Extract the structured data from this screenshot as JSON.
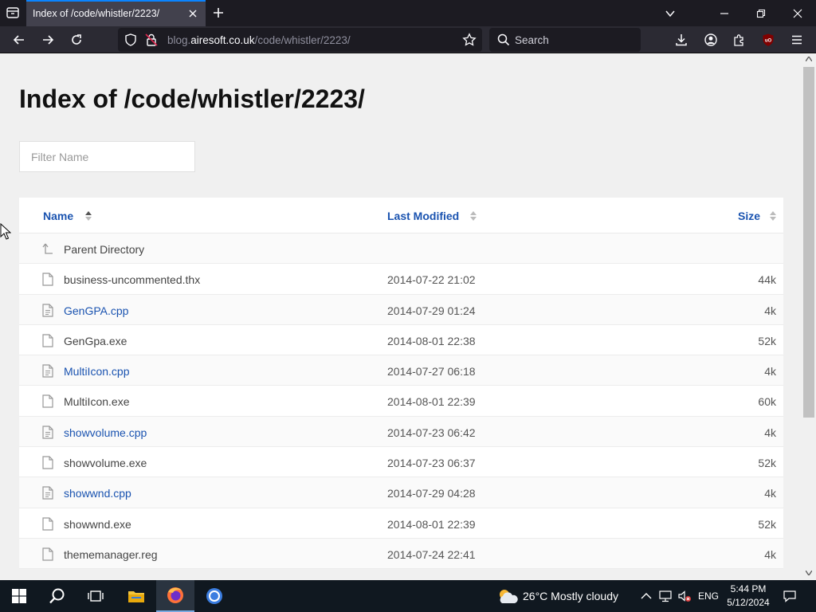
{
  "browser": {
    "tab_title": "Index of /code/whistler/2223/",
    "url_prefix": "blog.",
    "url_host": "airesoft.co.uk",
    "url_path": "/code/whistler/2223/",
    "search_placeholder": "Search"
  },
  "page": {
    "title": "Index of /code/whistler/2223/",
    "filter_placeholder": "Filter Name",
    "columns": {
      "name": "Name",
      "modified": "Last Modified",
      "size": "Size"
    },
    "parent_label": "Parent Directory",
    "files": [
      {
        "name": "business-uncommented.thx",
        "modified": "2014-07-22 21:02",
        "size": "44k"
      },
      {
        "name": "GenGPA.cpp",
        "modified": "2014-07-29 01:24",
        "size": "4k"
      },
      {
        "name": "GenGpa.exe",
        "modified": "2014-08-01 22:38",
        "size": "52k"
      },
      {
        "name": "MultiIcon.cpp",
        "modified": "2014-07-27 06:18",
        "size": "4k"
      },
      {
        "name": "MultiIcon.exe",
        "modified": "2014-08-01 22:39",
        "size": "60k"
      },
      {
        "name": "showvolume.cpp",
        "modified": "2014-07-23 06:42",
        "size": "4k"
      },
      {
        "name": "showvolume.exe",
        "modified": "2014-07-23 06:37",
        "size": "52k"
      },
      {
        "name": "showwnd.cpp",
        "modified": "2014-07-29 04:28",
        "size": "4k"
      },
      {
        "name": "showwnd.exe",
        "modified": "2014-08-01 22:39",
        "size": "52k"
      },
      {
        "name": "thememanager.reg",
        "modified": "2014-07-24 22:41",
        "size": "4k"
      }
    ]
  },
  "taskbar": {
    "weather": "26°C  Mostly cloudy",
    "language": "ENG",
    "time": "5:44 PM",
    "date": "5/12/2024"
  },
  "colors": {
    "link": "#1a53b0",
    "tab_accent": "#0a84ff",
    "chrome_dark": "#1c1b22",
    "toolbar": "#2b2a33",
    "taskbar": "#101820"
  }
}
